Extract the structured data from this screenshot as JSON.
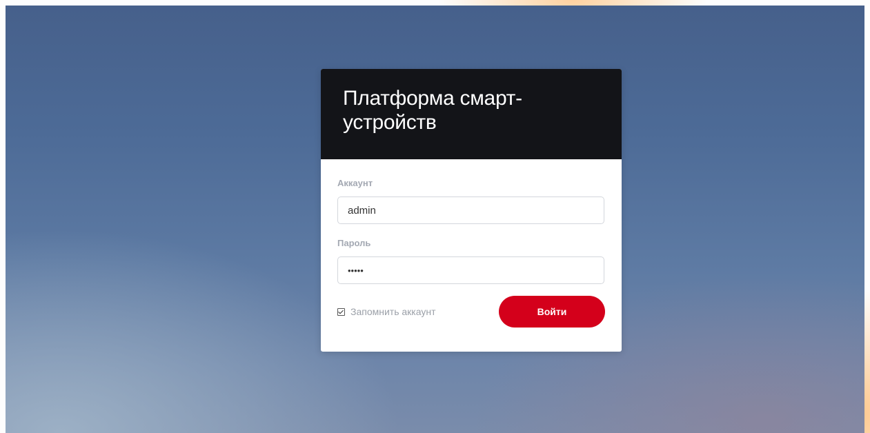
{
  "login": {
    "title": "Платформа смарт-устройств",
    "account": {
      "label": "Аккаунт",
      "value": "admin"
    },
    "password": {
      "label": "Пароль",
      "value": "•••••"
    },
    "remember": {
      "label": "Запомнить аккаунт",
      "checked": true
    },
    "submit_label": "Войти"
  },
  "colors": {
    "header_bg": "#131418",
    "accent": "#d4001b",
    "label": "#a3a8b2"
  }
}
